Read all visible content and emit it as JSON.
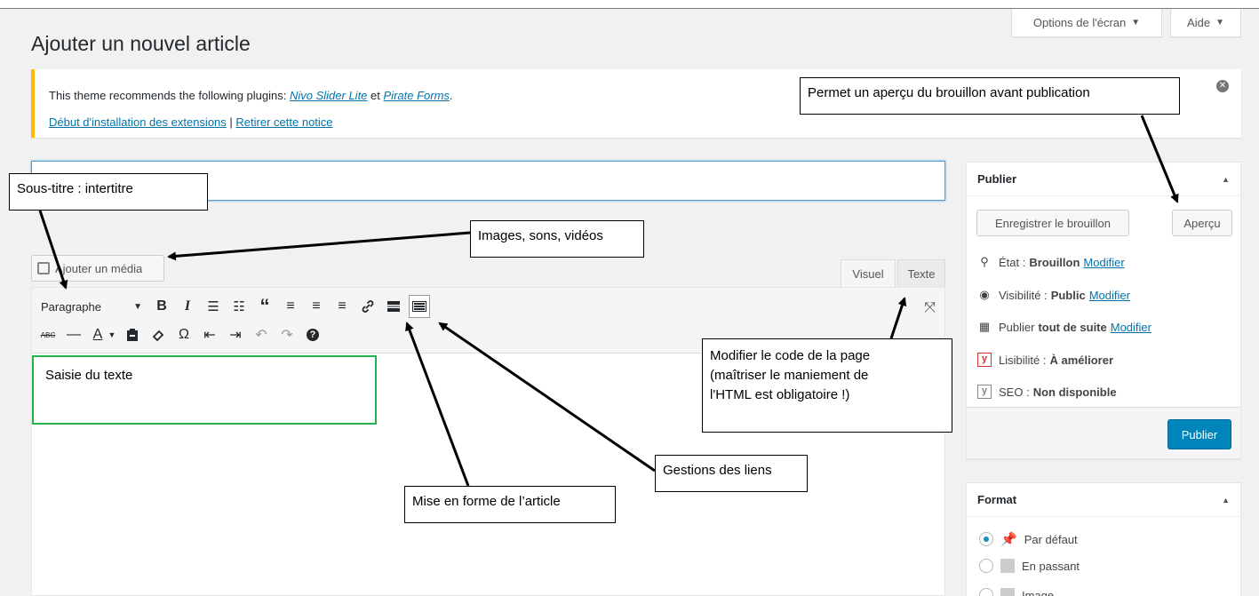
{
  "header": {
    "screen_options": "Options de l'écran",
    "help": "Aide",
    "page_title": "Ajouter un nouvel article"
  },
  "notice": {
    "line1_prefix": "This theme recommends the following plugins:",
    "plugin1": "Nivo Slider Lite",
    "connector": "et",
    "plugin2": "Pirate Forms",
    "line1_suffix": ".",
    "install_link": "Début d'installation des extensions",
    "separator": "|",
    "dismiss_link": "Retirer cette notice",
    "dismiss_icon": "x-circle-icon"
  },
  "editor": {
    "add_media": "Ajouter un média",
    "tab_visual": "Visuel",
    "tab_text": "Texte",
    "format_select": "Paragraphe",
    "toolbar_row1": [
      {
        "name": "bold-icon",
        "glyph": "B"
      },
      {
        "name": "italic-icon",
        "glyph": "I"
      },
      {
        "name": "bullet-list-icon",
        "glyph": "☰"
      },
      {
        "name": "numbered-list-icon",
        "glyph": "☷"
      },
      {
        "name": "blockquote-icon",
        "glyph": "❝"
      },
      {
        "name": "align-left-icon",
        "glyph": "≡"
      },
      {
        "name": "align-center-icon",
        "glyph": "≡"
      },
      {
        "name": "align-right-icon",
        "glyph": "≡"
      },
      {
        "name": "link-icon",
        "glyph": "🔗"
      },
      {
        "name": "read-more-icon",
        "glyph": "▬"
      },
      {
        "name": "toolbar-toggle-icon",
        "glyph": "▦"
      }
    ],
    "toolbar_row2": [
      {
        "name": "strikethrough-icon",
        "glyph": "ABC"
      },
      {
        "name": "horizontal-line-icon",
        "glyph": "—"
      },
      {
        "name": "text-color-icon",
        "glyph": "A"
      },
      {
        "name": "paste-text-icon",
        "glyph": "📋"
      },
      {
        "name": "clear-format-icon",
        "glyph": "◇"
      },
      {
        "name": "special-char-icon",
        "glyph": "Ω"
      },
      {
        "name": "outdent-icon",
        "glyph": "⇤"
      },
      {
        "name": "indent-icon",
        "glyph": "⇥"
      },
      {
        "name": "undo-icon",
        "glyph": "↶"
      },
      {
        "name": "redo-icon",
        "glyph": "↷"
      },
      {
        "name": "help-icon",
        "glyph": "?"
      }
    ]
  },
  "publish": {
    "title": "Publier",
    "save_draft": "Enregistrer le brouillon",
    "preview": "Aperçu",
    "status_label": "État :",
    "status_value": "Brouillon",
    "visibility_label": "Visibilité :",
    "visibility_value": "Public",
    "schedule_label": "Publier",
    "schedule_value": "tout de suite",
    "modify": "Modifier",
    "readability_label": "Lisibilité :",
    "readability_value": "À améliorer",
    "seo_label": "SEO :",
    "seo_value": "Non disponible",
    "publish_button": "Publier"
  },
  "format": {
    "title": "Format",
    "options": [
      "Par défaut",
      "En passant",
      "Image"
    ],
    "selected": "Par défaut"
  },
  "annotations": {
    "preview_note": "Permet un aperçu du brouillon avant publication",
    "subtitle_note": "Sous-titre : intertitre",
    "media_note": "Images, sons, vidéos",
    "text_input_note": "Saisie du texte",
    "code_note_1": "Modifier le code de la page",
    "code_note_2": "(maîtriser le maniement de",
    "code_note_3": "l'HTML est obligatoire !)",
    "links_note": "Gestions des liens",
    "format_note": "Mise en forme de l’article"
  },
  "colors": {
    "link": "#0073aa",
    "primary": "#0085ba",
    "notice_warning": "#ffb900",
    "annotation_green": "#22b14c"
  }
}
